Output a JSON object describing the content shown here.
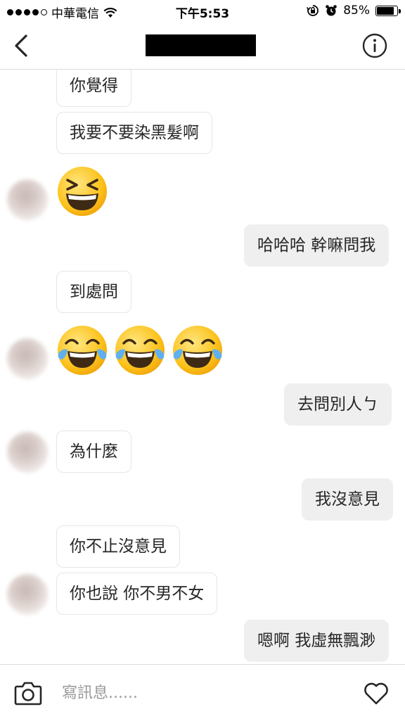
{
  "status": {
    "carrier": "中華電信",
    "time": "下午5:53",
    "battery": "85%",
    "battery_level": 0.85,
    "icons": [
      "signal-dots-icon",
      "wifi-icon",
      "orientation-lock-icon",
      "alarm-icon",
      "battery-icon"
    ]
  },
  "header": {
    "back_icon": "chevron-left-icon",
    "info_icon": "info-icon"
  },
  "messages": [
    {
      "side": "in",
      "text": "你覺得"
    },
    {
      "side": "in",
      "text": "我要不要染黑髮啊"
    },
    {
      "side": "in",
      "emoji": [
        "grinning-squinting-face"
      ]
    },
    {
      "side": "out",
      "text": "哈哈哈 幹嘛問我"
    },
    {
      "side": "in",
      "text": "到處問"
    },
    {
      "side": "in",
      "emoji": [
        "face-with-tears-of-joy",
        "face-with-tears-of-joy",
        "face-with-tears-of-joy"
      ]
    },
    {
      "side": "out",
      "text": "去問別人ㄅ"
    },
    {
      "side": "in",
      "text": "為什麼"
    },
    {
      "side": "out",
      "text": "我沒意見"
    },
    {
      "side": "in",
      "text": "你不止沒意見"
    },
    {
      "side": "in",
      "text": "你也說 你不男不女"
    },
    {
      "side": "out",
      "text": "嗯啊 我虛無飄渺"
    }
  ],
  "composer": {
    "placeholder": "寫訊息......",
    "camera_icon": "camera-icon",
    "like_icon": "heart-icon"
  }
}
